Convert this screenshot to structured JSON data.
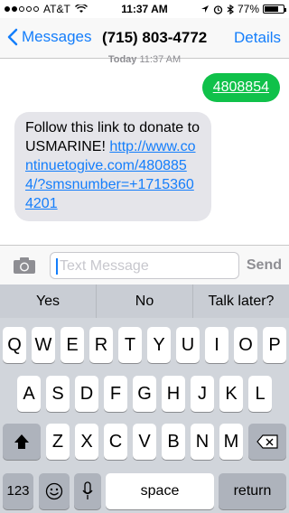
{
  "status": {
    "carrier": "AT&T",
    "time": "11:37 AM",
    "battery": "77%",
    "battery_level": 0.77
  },
  "nav": {
    "back_label": "Messages",
    "title": "(715) 803-4772",
    "details_label": "Details"
  },
  "conversation": {
    "timestamp_day": "Today",
    "timestamp_time": "11:37 AM",
    "outgoing": "4808854",
    "incoming_text": "Follow this link to donate to USMARINE! ",
    "incoming_link": "http://www.continuetogive.com/4808854/?smsnumber=+17153604201"
  },
  "input": {
    "placeholder": "Text Message",
    "send_label": "Send"
  },
  "keyboard": {
    "predictions": [
      "Yes",
      "No",
      "Talk later?"
    ],
    "row1": [
      "Q",
      "W",
      "E",
      "R",
      "T",
      "Y",
      "U",
      "I",
      "O",
      "P"
    ],
    "row2": [
      "A",
      "S",
      "D",
      "F",
      "G",
      "H",
      "J",
      "K",
      "L"
    ],
    "row3": [
      "Z",
      "X",
      "C",
      "V",
      "B",
      "N",
      "M"
    ],
    "numbers_label": "123",
    "space_label": "space",
    "return_label": "return"
  },
  "colors": {
    "ios_blue": "#147efb",
    "imessage_green": "#10c14a",
    "incoming_gray": "#e5e5ea"
  }
}
